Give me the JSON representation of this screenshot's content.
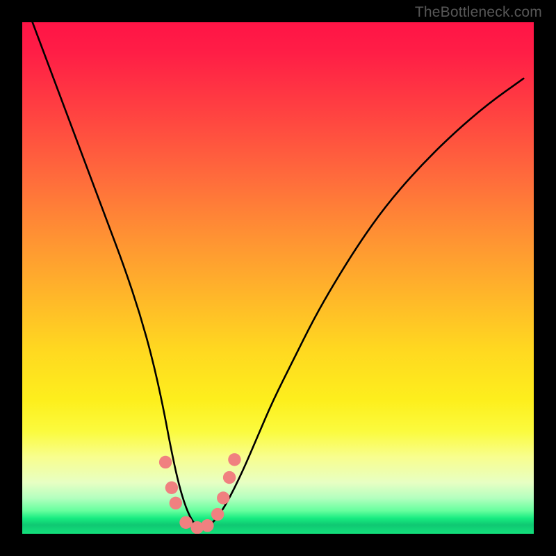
{
  "watermark": "TheBottleneck.com",
  "chart_data": {
    "type": "line",
    "title": "",
    "xlabel": "",
    "ylabel": "",
    "xlim": [
      0,
      100
    ],
    "ylim": [
      0,
      100
    ],
    "grid": false,
    "legend": false,
    "series": [
      {
        "name": "curve",
        "color": "#000000",
        "x": [
          2,
          5,
          8,
          11,
          14,
          17,
          20,
          23,
          25.5,
          27.5,
          29,
          30.5,
          32,
          33.5,
          35,
          36.5,
          38,
          40,
          43,
          46,
          49,
          53,
          57,
          61,
          66,
          71,
          77,
          84,
          91,
          98
        ],
        "y": [
          100,
          92,
          84,
          76,
          68,
          60,
          52,
          43,
          34,
          25,
          17,
          10,
          5,
          2,
          1,
          1.5,
          3,
          6,
          12,
          19,
          26,
          34,
          42,
          49,
          57,
          64,
          71,
          78,
          84,
          89
        ]
      }
    ],
    "markers": {
      "name": "dots",
      "color": "#f08080",
      "radius_pct": 1.25,
      "points": [
        {
          "x": 28.0,
          "y": 14.0
        },
        {
          "x": 29.2,
          "y": 9.0
        },
        {
          "x": 30.0,
          "y": 6.0
        },
        {
          "x": 32.0,
          "y": 2.2
        },
        {
          "x": 34.2,
          "y": 1.2
        },
        {
          "x": 36.2,
          "y": 1.6
        },
        {
          "x": 38.2,
          "y": 3.8
        },
        {
          "x": 39.3,
          "y": 7.0
        },
        {
          "x": 40.5,
          "y": 11.0
        },
        {
          "x": 41.5,
          "y": 14.5
        }
      ]
    },
    "gradient_stops": [
      {
        "pos": 0,
        "color": "#ff1446"
      },
      {
        "pos": 0.5,
        "color": "#ffd820"
      },
      {
        "pos": 0.9,
        "color": "#e7ffc3"
      },
      {
        "pos": 1.0,
        "color": "#13e27c"
      }
    ]
  }
}
